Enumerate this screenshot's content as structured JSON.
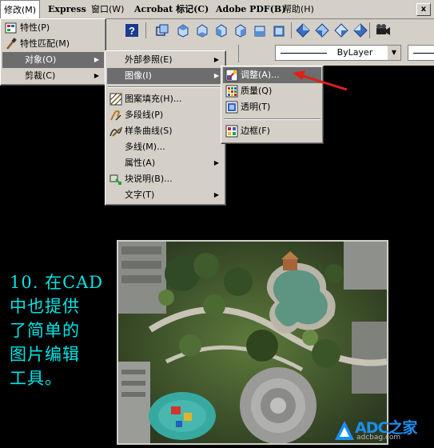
{
  "menubar": {
    "items": [
      "修改(M)",
      "Express",
      "窗口(W)",
      "Acrobat 标记(C)",
      "Adobe PDF(B)",
      "帮助(H)"
    ],
    "close_glyph": "x"
  },
  "toolbar2": {
    "layer_combo": "ByLayer"
  },
  "modify_menu": {
    "items": [
      {
        "label": "特性(P)",
        "icon": "properties-icon"
      },
      {
        "label": "特性匹配(M)",
        "icon": "match-properties-icon"
      },
      {
        "label": "对象(O)",
        "submenu": true,
        "selected": true
      },
      {
        "label": "剪裁(C)",
        "submenu": true
      }
    ]
  },
  "object_menu": {
    "items": [
      {
        "label": "外部参照(E)",
        "submenu": true
      },
      {
        "label": "图像(I)",
        "submenu": true,
        "selected": true
      },
      {
        "label": "图案填充(H)...",
        "icon": "hatch-icon"
      },
      {
        "label": "多段线(P)",
        "icon": "polyline-icon"
      },
      {
        "label": "样条曲线(S)",
        "icon": "spline-icon"
      },
      {
        "label": "多线(M)..."
      },
      {
        "label": "属性(A)",
        "submenu": true
      },
      {
        "label": "块说明(B)...",
        "icon": "block-description-icon"
      },
      {
        "label": "文字(T)",
        "submenu": true
      }
    ]
  },
  "image_menu": {
    "items": [
      {
        "label": "调整(A)...",
        "icon": "image-adjust-icon",
        "selected": true
      },
      {
        "label": "质量(Q)",
        "icon": "image-quality-icon"
      },
      {
        "label": "透明(T)",
        "icon": "transparency-icon"
      },
      {
        "label": "边框(F)",
        "icon": "frame-icon"
      }
    ]
  },
  "caption": {
    "line1": "10. 在CAD",
    "line2": "中也提供",
    "line3": "了简单的",
    "line4": "图片编辑",
    "line5": "工具。"
  },
  "watermark": {
    "text": "ADC之家",
    "sub": "adcbag.com"
  },
  "colors": {
    "menu_bg": "#d4d0c8",
    "highlight": "#6d6d6d",
    "caption": "#00e5e5",
    "arrow": "#e0201a",
    "desktop": "#000000"
  }
}
